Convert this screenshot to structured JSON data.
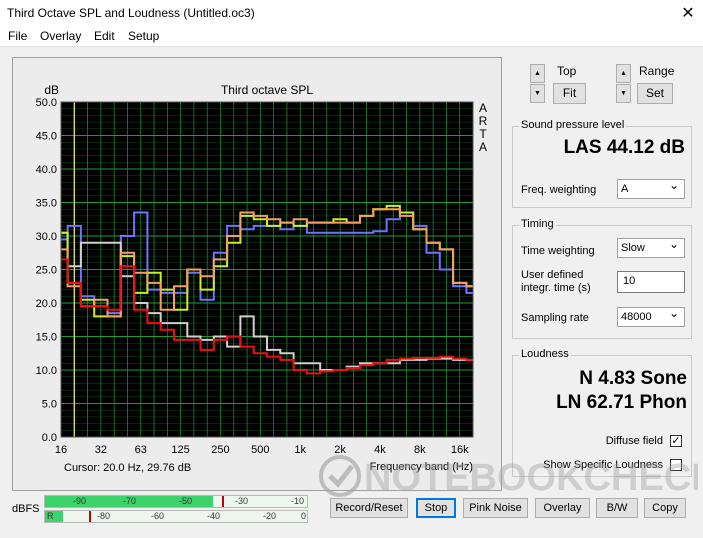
{
  "window": {
    "title": "Third Octave SPL and Loudness (Untitled.oc3)",
    "close_glyph": "✕"
  },
  "menu": [
    {
      "label": "File",
      "underline": "F"
    },
    {
      "label": "Overlay",
      "underline": "O"
    },
    {
      "label": "Edit",
      "underline": "E"
    },
    {
      "label": "Setup",
      "underline": "S"
    }
  ],
  "chart_data": {
    "type": "line",
    "title": "Third octave SPL",
    "ylabel": "dB",
    "xlabel": "Frequency band (Hz)",
    "side_label": [
      "A",
      "R",
      "T",
      "A"
    ],
    "ylim": [
      0,
      50
    ],
    "ytick_labels": [
      "50.0",
      "45.0",
      "40.0",
      "35.0",
      "30.0",
      "25.0",
      "20.0",
      "15.0",
      "10.0",
      "5.0",
      "0.0"
    ],
    "xtick_labels": [
      {
        "band": 0,
        "label": "16"
      },
      {
        "band": 3,
        "label": "32"
      },
      {
        "band": 6,
        "label": "63"
      },
      {
        "band": 9,
        "label": "125"
      },
      {
        "band": 12,
        "label": "250"
      },
      {
        "band": 15,
        "label": "500"
      },
      {
        "band": 18,
        "label": "1k"
      },
      {
        "band": 21,
        "label": "2k"
      },
      {
        "band": 24,
        "label": "4k"
      },
      {
        "band": 27,
        "label": "8k"
      },
      {
        "band": 30,
        "label": "16k"
      }
    ],
    "bands": [
      "16",
      "20",
      "25",
      "31.5",
      "40",
      "50",
      "63",
      "80",
      "100",
      "125",
      "160",
      "200",
      "250",
      "315",
      "400",
      "500",
      "630",
      "800",
      "1k",
      "1.25k",
      "1.6k",
      "2k",
      "2.5k",
      "3.15k",
      "4k",
      "5k",
      "6.3k",
      "8k",
      "10k",
      "12.5k",
      "16k",
      "20k"
    ],
    "grid": true,
    "background": "#000000",
    "grid_color": "#1f9b36",
    "series": [
      {
        "color": "#6f74ff",
        "values": [
          29.5,
          31.5,
          21.0,
          19.5,
          18.5,
          30.0,
          33.5,
          22.0,
          21.5,
          21.5,
          24.5,
          20.5,
          27.5,
          31.5,
          31.0,
          31.5,
          31.5,
          31.0,
          31.5,
          30.5,
          30.5,
          30.5,
          30.5,
          30.5,
          30.7,
          32.5,
          33.5,
          31.5,
          27.5,
          25.0,
          22.5,
          21.5
        ]
      },
      {
        "color": "#d0d0d0",
        "values": [
          30.5,
          25.5,
          29.0,
          29.0,
          29.0,
          24.0,
          20.0,
          18.5,
          17.0,
          17.0,
          15.0,
          14.5,
          15.0,
          13.5,
          18.0,
          15.0,
          13.0,
          12.5,
          11.0,
          11.0,
          10.0,
          10.0,
          10.5,
          11.0,
          11.0,
          11.0,
          11.5,
          11.5,
          11.7,
          11.7,
          11.5,
          11.5
        ]
      },
      {
        "color": "#c8f020",
        "values": [
          30.5,
          23.0,
          20.5,
          18.0,
          18.0,
          27.0,
          21.5,
          24.5,
          22.0,
          19.0,
          25.0,
          22.0,
          25.5,
          29.0,
          33.0,
          32.5,
          31.5,
          32.0,
          31.5,
          32.0,
          32.0,
          32.5,
          32.0,
          33.0,
          34.0,
          34.5,
          33.5,
          31.0,
          29.0,
          28.0,
          23.0,
          22.5
        ]
      },
      {
        "color": "#f4a060",
        "values": [
          28.0,
          22.5,
          19.5,
          20.5,
          18.0,
          27.5,
          24.5,
          23.0,
          19.0,
          22.5,
          25.0,
          24.0,
          26.5,
          30.0,
          33.5,
          33.0,
          32.5,
          32.0,
          32.5,
          32.0,
          32.0,
          32.0,
          32.0,
          33.0,
          34.0,
          34.0,
          33.0,
          31.0,
          29.0,
          28.0,
          23.0,
          22.5
        ]
      },
      {
        "color": "#ee1010",
        "values": [
          26.5,
          23.0,
          19.5,
          19.5,
          19.0,
          25.5,
          19.0,
          17.0,
          16.0,
          14.5,
          14.5,
          13.0,
          14.5,
          15.0,
          13.5,
          12.5,
          12.0,
          11.5,
          10.0,
          9.5,
          9.8,
          10.0,
          10.3,
          10.7,
          11.0,
          11.5,
          11.7,
          11.8,
          11.8,
          12.0,
          11.7,
          11.5
        ]
      }
    ],
    "cursor_band": 1
  },
  "cursor": {
    "text": "Cursor:   20.0 Hz, 29.76 dB"
  },
  "controls": {
    "top_label": "Top",
    "fit_label": "Fit",
    "range_label": "Range",
    "set_label": "Set",
    "spin_up": "▲",
    "spin_down": "▼"
  },
  "spl": {
    "group_title": "Sound pressure level",
    "value": "LAS 44.12 dB",
    "freq_label": "Freq. weighting",
    "freq_value": "A"
  },
  "timing": {
    "group_title": "Timing",
    "tw_label": "Time weighting",
    "tw_value": "Slow",
    "udit_label_1": "User defined",
    "udit_label_2": "integr. time (s)",
    "udit_value": "10",
    "sr_label": "Sampling rate",
    "sr_value": "48000"
  },
  "loudness": {
    "group_title": "Loudness",
    "sone": "N 4.83 Sone",
    "phon": "LN 62.71 Phon",
    "diffuse_label": "Diffuse field",
    "diffuse_checked": "✓",
    "specific_label": "Show Specific Loudness"
  },
  "meter": {
    "label": "dBFS",
    "top_ticks": [
      "-90",
      "-70",
      "-50",
      "-30",
      "-10"
    ],
    "bottom_ticks": [
      "R",
      "-80",
      "-60",
      "-40",
      "-20",
      "0"
    ],
    "top_level": 0.64,
    "bottom_level": 0.07
  },
  "buttons": {
    "record": "Record/Reset",
    "stop": "Stop",
    "pink": "Pink Noise",
    "overlay": "Overlay",
    "bw": "B/W",
    "copy": "Copy"
  },
  "watermark": "NOTEBOOKCHECK"
}
